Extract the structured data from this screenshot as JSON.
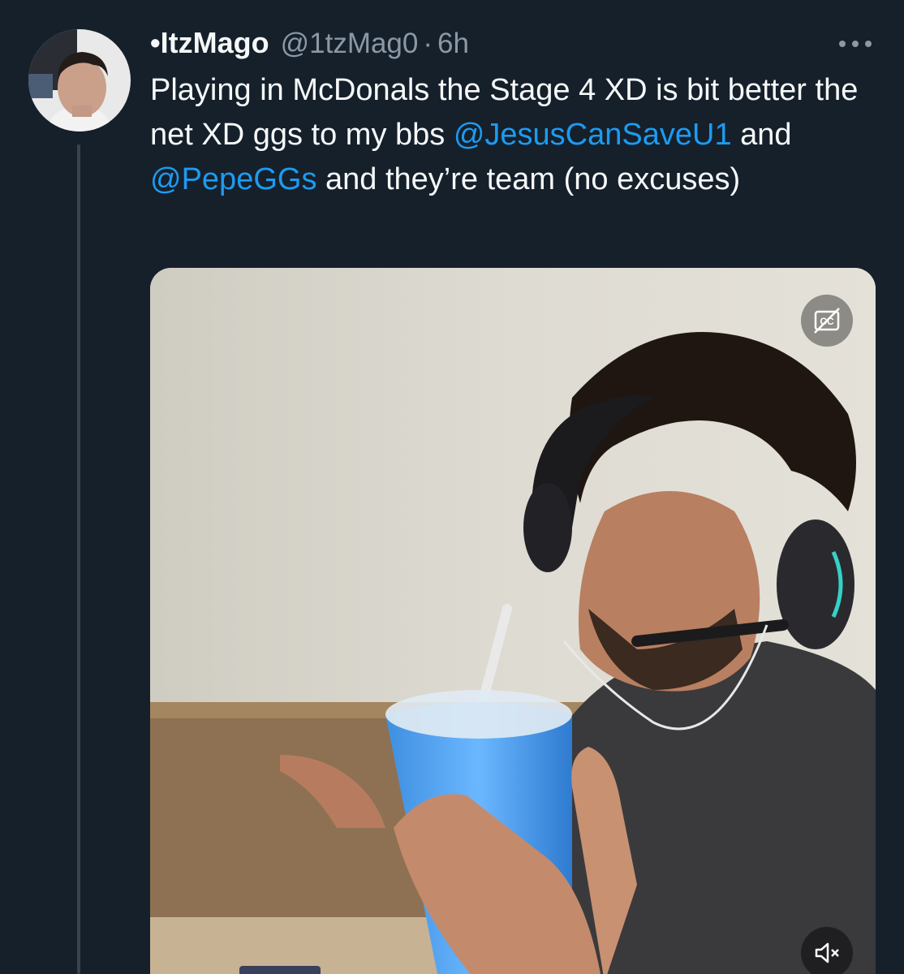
{
  "tweet": {
    "display_name": "•ItzMago",
    "handle": "@1tzMag0",
    "separator": "·",
    "time": "6h",
    "more_icon": "more-horizontal-icon",
    "text": {
      "part1": "Playing in McDonals the Stage 4 XD is bit better the net XD ggs to my bbs ",
      "mention1": "@JesusCanSaveU1",
      "part2": " and ",
      "mention2": "@PepeGGs",
      "part3": " and they’re team (no excuses)"
    },
    "avatar_icon": "user-avatar",
    "video": {
      "captions_icon": "closed-captions-off-icon",
      "mute_icon": "volume-muted-icon"
    },
    "colors": {
      "background": "#15202b",
      "text": "#f7f9f9",
      "secondary": "#8b98a5",
      "link": "#1d9bf0",
      "thread_line": "#38444d"
    }
  }
}
